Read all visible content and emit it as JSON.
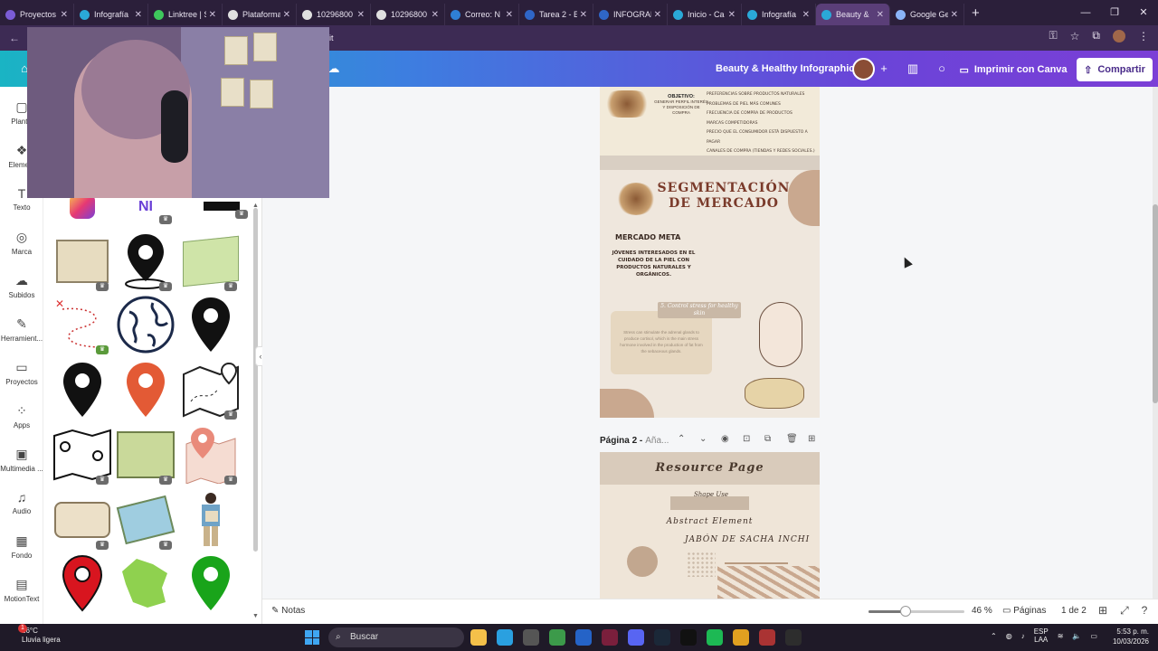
{
  "browser": {
    "tabs": [
      {
        "label": "Proyectos",
        "color": "#7b5cd6"
      },
      {
        "label": "Infografía",
        "color": "#2aa9d8"
      },
      {
        "label": "Linktree | S",
        "color": "#3ec75c"
      },
      {
        "label": "Plataforma",
        "color": "#e0e0e0"
      },
      {
        "label": "10296800",
        "color": "#e0e0e0"
      },
      {
        "label": "10296800",
        "color": "#e0e0e0"
      },
      {
        "label": "Correo: N",
        "color": "#2f7fd6"
      },
      {
        "label": "Tarea 2 - E",
        "color": "#2f66c7"
      },
      {
        "label": "INFOGRAF",
        "color": "#2f66c7"
      },
      {
        "label": "Inicio - Ca",
        "color": "#2aa9d8"
      },
      {
        "label": "Infografía",
        "color": "#2aa9d8"
      },
      {
        "label": "Beauty &",
        "color": "#2aa9d8",
        "active": true
      },
      {
        "label": "Google Ge",
        "color": "#8ab4f8"
      }
    ],
    "url_fragment": "it"
  },
  "canva": {
    "doc_title": "Beauty & Healthy Infographic",
    "print_label": "Imprimir con Canva",
    "share_label": "Compartir"
  },
  "rail": [
    {
      "label": "Plantill",
      "icon": "template-icon"
    },
    {
      "label": "Element",
      "icon": "elements-icon"
    },
    {
      "label": "Texto",
      "icon": "text-icon"
    },
    {
      "label": "Marca",
      "icon": "brand-icon"
    },
    {
      "label": "Subidos",
      "icon": "upload-icon"
    },
    {
      "label": "Herramient...",
      "icon": "tools-icon"
    },
    {
      "label": "Proyectos",
      "icon": "folder-icon"
    },
    {
      "label": "Apps",
      "icon": "apps-icon"
    },
    {
      "label": "Multimedia ...",
      "icon": "multimedia-icon"
    },
    {
      "label": "Audio",
      "icon": "audio-icon"
    },
    {
      "label": "Fondo",
      "icon": "background-icon"
    },
    {
      "label": "MotionText",
      "icon": "motiontext-icon"
    }
  ],
  "page1": {
    "list_items": [
      "PREFERENCIAS SOBRE PRODUCTOS NATURALES",
      "PROBLEMAS DE PIEL MÁS COMUNES",
      "FRECUENCIA DE COMPRA DE PRODUCTOS",
      "MARCAS COMPETIDORAS",
      "PRECIO QUE EL CONSUMIDOR ESTÁ DISPUESTO A PAGAR",
      "CANALES DE COMPRA (TIENDAS Y REDES SOCIALES.)"
    ],
    "objective_title": "OBJETIVO:",
    "objective_text": "GENERAR PERFIL INTERÉS Y DISPOSICIÓN DE COMPRA",
    "segment_title": "SEGMENTACIÓN DE MERCADO",
    "market_title": "MERCADO META",
    "market_text": "JÓVENES INTERESADOS EN EL CUIDADO DE LA PIEL CON PRODUCTOS NATURALES Y ORGÁNICOS.",
    "stress_title": "5. Control stress for healthy skin",
    "stress_text": "Stress can stimulate the adrenal glands to produce cortisol, which is the main stress hormone involved in the production of fat from the sebaceous glands."
  },
  "pagebar": {
    "label": "Página 2 -",
    "name_placeholder": "Añadir título",
    "name_shown": "Aña..."
  },
  "page2": {
    "title": "Resource Page",
    "shape_use": "Shape Use",
    "abstract": "Abstract Element",
    "jabon": "JABÓN DE SACHA INCHI"
  },
  "bottom": {
    "notes": "Notas",
    "zoom_value": 0.46,
    "zoom": "46 %",
    "pages_label": "Páginas",
    "page_count": "1 de 2"
  },
  "taskbar": {
    "temp": "26°C",
    "weather": "Lluvia ligera",
    "search": "Buscar",
    "lang1": "ESP",
    "lang2": "LAA",
    "time": "5:53 p. m.",
    "date": "10/03/2026",
    "notif_count": "1"
  }
}
